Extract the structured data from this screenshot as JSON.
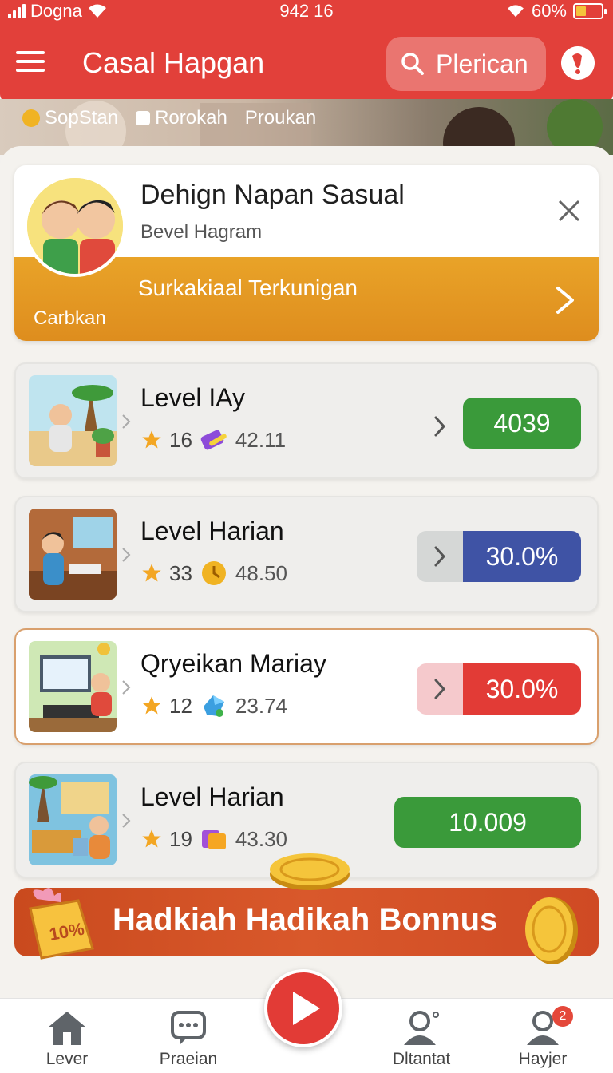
{
  "status_bar": {
    "carrier": "Dogna",
    "time": "942 16",
    "battery": "60%"
  },
  "header": {
    "title": "Casal Hapgan",
    "search_label": "Plerican"
  },
  "chips": [
    "SopStan",
    "Rorokah",
    "Proukan"
  ],
  "promo": {
    "title": "Dehign Napan Sasual",
    "subtitle": "Bevel Hagram",
    "cta": "Surkakiaal Terkunigan",
    "small": "Carbkan"
  },
  "levels": [
    {
      "title": "Level IAy",
      "stars": "16",
      "score": "42.11",
      "value": "4039",
      "color": "#3a9a3a"
    },
    {
      "title": "Level Harian",
      "stars": "33",
      "score": "48.50",
      "value": "30.0%",
      "color": "#3f53a5"
    },
    {
      "title": "Qryeikan Mariay",
      "stars": "12",
      "score": "23.74",
      "value": "30.0%",
      "color": "#e23b36"
    },
    {
      "title": "Level Harian",
      "stars": "19",
      "score": "43.30",
      "value": "10.009",
      "color": "#3a9a3a"
    }
  ],
  "bonus": {
    "text": "Hadkiah Hadikah Bonnus",
    "tag": "10%"
  },
  "nav": [
    {
      "label": "Lever",
      "icon": "home-icon"
    },
    {
      "label": "Praeian",
      "icon": "chat-icon"
    },
    {
      "label": "Dltantat",
      "icon": "user-icon"
    },
    {
      "label": "Hayjer",
      "icon": "profile-icon",
      "badge": "2"
    }
  ]
}
